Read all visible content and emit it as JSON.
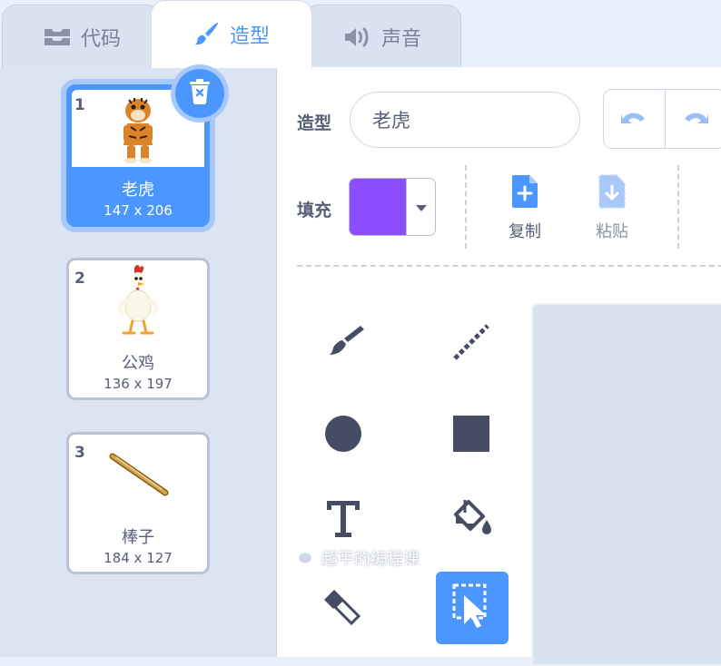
{
  "tabs": [
    {
      "label": "代码",
      "icon": "code-blocks-icon",
      "active": false
    },
    {
      "label": "造型",
      "icon": "paintbrush-icon",
      "active": true
    },
    {
      "label": "声音",
      "icon": "speaker-icon",
      "active": false
    }
  ],
  "costumes": [
    {
      "number": "1",
      "name": "老虎",
      "size": "147 x 206",
      "thumbnail": "tiger",
      "selected": true
    },
    {
      "number": "2",
      "name": "公鸡",
      "size": "136 x 197",
      "thumbnail": "rooster",
      "selected": false
    },
    {
      "number": "3",
      "name": "棒子",
      "size": "184 x 127",
      "thumbnail": "stick",
      "selected": false
    }
  ],
  "editor": {
    "costume_label": "造型",
    "costume_name": "老虎",
    "fill_label": "填充",
    "fill_color": "#8a4dff",
    "copy_label": "复制",
    "paste_label": "粘贴"
  },
  "tools": [
    {
      "name": "brush-tool",
      "icon": "brush-icon"
    },
    {
      "name": "line-tool",
      "icon": "line-icon"
    },
    {
      "name": "circle-tool",
      "icon": "circle-icon"
    },
    {
      "name": "rectangle-tool",
      "icon": "rectangle-icon"
    },
    {
      "name": "text-tool",
      "icon": "text-icon"
    },
    {
      "name": "fill-tool",
      "icon": "fill-bucket-icon"
    },
    {
      "name": "eraser-tool",
      "icon": "eraser-icon"
    },
    {
      "name": "select-tool",
      "icon": "select-icon",
      "active": true
    }
  ],
  "watermark": "超平的编程课",
  "colors": {
    "accent": "#4c97ff",
    "fill": "#8a4dff",
    "text": "#575e75"
  }
}
